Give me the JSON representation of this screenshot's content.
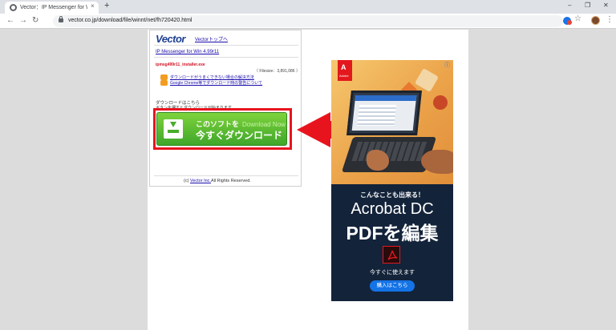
{
  "browser": {
    "tab_title": "Vector：IP Messenger for Win の",
    "tab_close": "×",
    "new_tab": "+",
    "window_controls": {
      "minimize": "–",
      "maximize": "❐",
      "close": "✕"
    },
    "nav": {
      "back": "←",
      "forward": "→",
      "reload": "↻"
    },
    "url": "vector.co.jp/download/file/winnt/net/fh720420.html",
    "star": "☆",
    "menu": "⋮"
  },
  "page": {
    "logo": "Vector",
    "top_link": "Vectorトップへ",
    "software_title": "IP Messenger for Win 4.99r11",
    "file_name": "ipmsg499r11_installer.exe",
    "file_size": "（ Filesize：3,891,086 ）",
    "help_links": [
      "ダウンロードがうまくできない場合の解決方法",
      "Google Chrome等でダウンロード時の警告について"
    ],
    "download_heading": "ダウンロードはこちら",
    "download_note": "ボタンを押すとダウンロードが始まります",
    "download_button": {
      "line1": "このソフトを",
      "line1_en": "Download Now",
      "line2": "今すぐダウンロード"
    },
    "copyright_prefix": "(c)",
    "copyright_link": "Vector Inc.",
    "copyright_suffix": "All Rights Reserved."
  },
  "ad": {
    "brand": "Adobe",
    "brand_letter": "A",
    "info_icon": "ⓘ",
    "tagline": "こんなことも出来る！",
    "product": "Acrobat DC",
    "headline": "PDFを編集",
    "subtext": "今すぐに使えます",
    "cta": "購入はこちら"
  },
  "colors": {
    "highlight_box": "#e8141d",
    "arrow": "#e8141d",
    "button_green": "#48ad2b",
    "link_blue": "#1a0dab",
    "adobe_red": "#e3181d",
    "ad_dark": "#13233a"
  },
  "icons": [
    "globe-favicon-icon",
    "lock-icon",
    "star-icon",
    "extension-icon",
    "download-arrow-icon",
    "pdf-icon",
    "info-icon"
  ]
}
